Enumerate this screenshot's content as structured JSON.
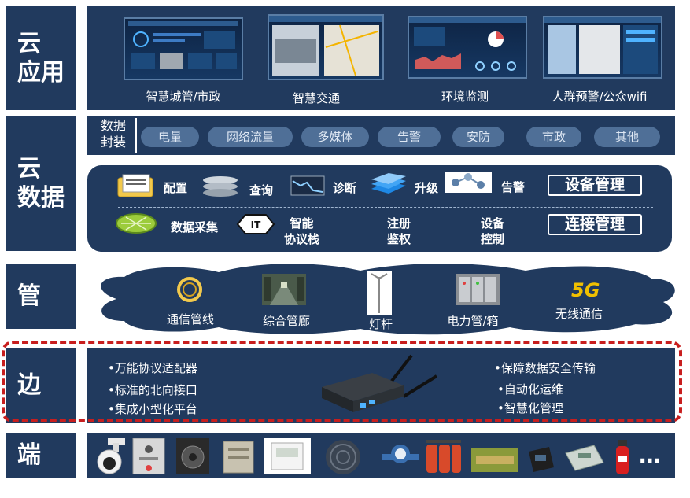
{
  "layers": {
    "cloud_app": "云\n应用",
    "cloud_data": "云\n数据",
    "pipe": "管",
    "edge": "边",
    "terminal": "端"
  },
  "apps": [
    {
      "label": "智慧城管/市政"
    },
    {
      "label": "智慧交通"
    },
    {
      "label": "环境监测"
    },
    {
      "label": "人群预警/公众wifi"
    }
  ],
  "data_pack_label": "数据\n封装",
  "data_types": [
    "电量",
    "网络流量",
    "多媒体",
    "告警",
    "安防",
    "市政",
    "其他"
  ],
  "device_functions": {
    "items": [
      "配置",
      "查询",
      "诊断",
      "升级",
      "告警"
    ],
    "title": "设备管理"
  },
  "connection_functions": {
    "items": [
      "数据采集",
      "智能\n协议栈",
      "注册\n鉴权",
      "设备\n控制"
    ],
    "title": "连接管理"
  },
  "pipes": [
    "通信管线",
    "综合管廊",
    "灯杆",
    "电力管/箱"
  ],
  "wireless": {
    "badge": "5G",
    "label": "无线通信"
  },
  "edge": {
    "left": [
      "•万能协议适配器",
      "•标准的北向接口",
      "•集成小型化平台"
    ],
    "right": [
      "•保障数据安全传输",
      "•自动化运维",
      "•智慧化管理"
    ]
  },
  "terminal_more": "…",
  "colors": {
    "navy": "#213a5e",
    "pill": "#4f6f97",
    "dash": "#c81e1e",
    "accent": "#f0c000"
  }
}
